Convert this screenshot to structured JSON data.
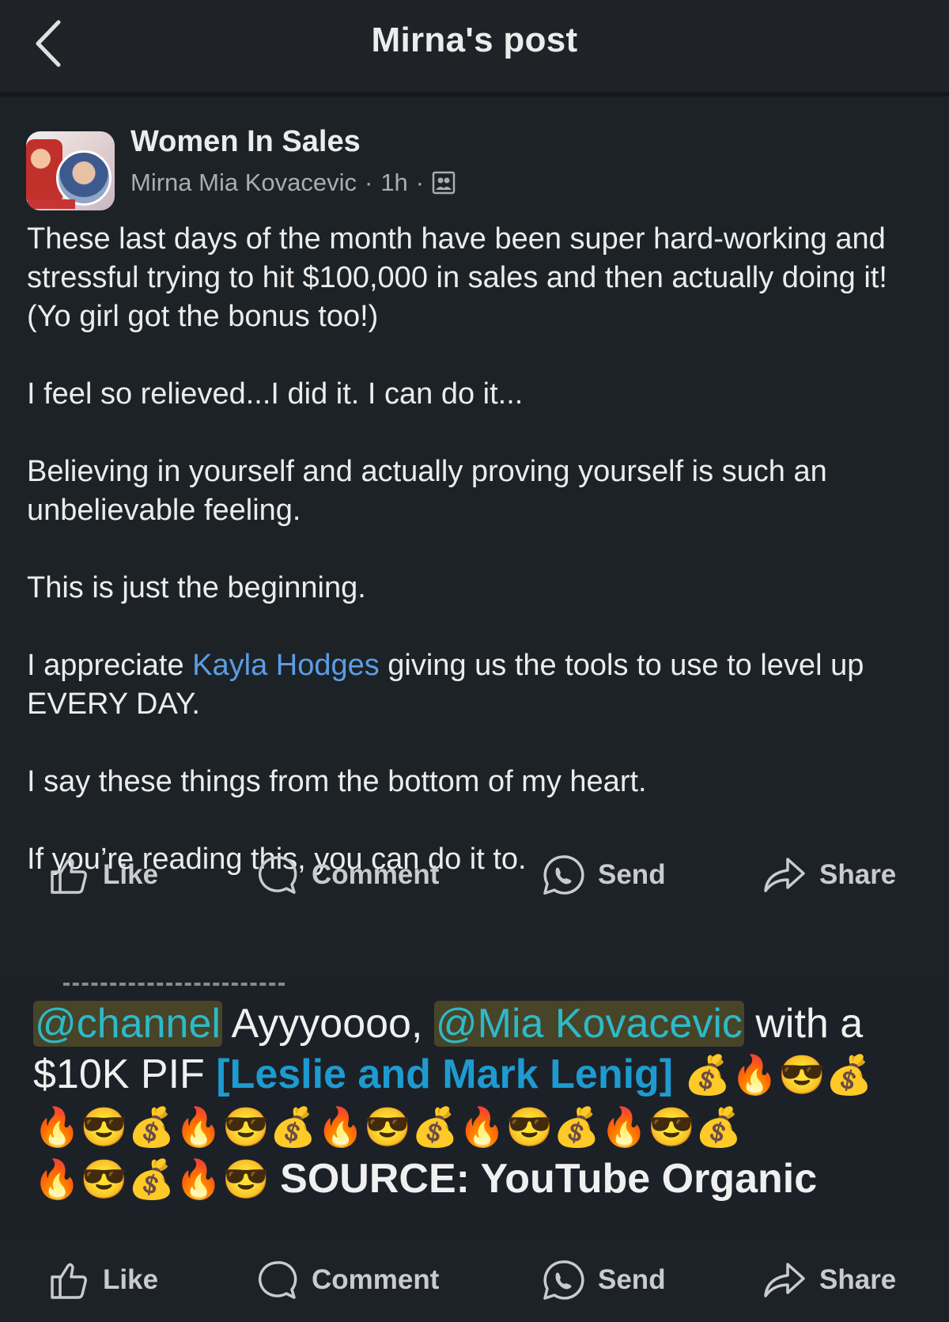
{
  "header": {
    "title": "Mirna's post"
  },
  "post": {
    "group_name": "Women In Sales",
    "author": "Mirna Mia Kovacevic",
    "separator": "·",
    "time": "1h",
    "paragraphs": [
      "These last days of the month have been super hard-working and stressful trying to hit $100,000 in sales and then actually doing it! (Yo girl got the bonus too!)",
      "I feel so relieved...I did it. I can do it...",
      "Believing in yourself and actually proving yourself is such an unbelievable feeling.",
      "This is just the beginning."
    ],
    "appreciate_prefix": "I appreciate ",
    "appreciate_mention": "Kayla Hodges",
    "appreciate_suffix": " giving us the tools to use to level up EVERY DAY.",
    "paragraphs_after": [
      "I say these things from the bottom of my heart.",
      "If you’re reading this, you can do it to."
    ]
  },
  "actions": {
    "like": "Like",
    "comment": "Comment",
    "send": "Send",
    "share": "Share"
  },
  "slack": {
    "channel_mention": "@channel",
    "text1": " Ayyyoooo, ",
    "user_mention": "@Mia Kovacevic",
    "text2": " with a $10K PIF ",
    "link": "[Leslie and Mark Lenig]",
    "emoji_line1": " 💰🔥😎💰",
    "emoji_line2": "🔥😎💰🔥😎💰🔥😎💰🔥😎💰🔥😎💰",
    "emoji_line3": "🔥😎💰🔥😎 ",
    "source": "SOURCE: YouTube Organic"
  },
  "colors": {
    "background": "#1d2226",
    "mention": "#5b9de6",
    "slack_link": "#1d9bd1",
    "slack_chip": "#474428"
  }
}
